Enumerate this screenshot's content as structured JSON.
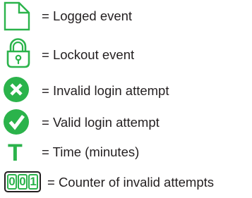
{
  "colors": {
    "accent_green": "#2bb34b",
    "text": "#231f20"
  },
  "legend": {
    "items": [
      {
        "icon": "document-icon",
        "label": "= Logged event"
      },
      {
        "icon": "padlock-icon",
        "label": "= Lockout event"
      },
      {
        "icon": "x-circle-icon",
        "label": "= Invalid login attempt"
      },
      {
        "icon": "check-circle-icon",
        "label": "= Valid login attempt"
      },
      {
        "icon": "t-letter-icon",
        "label": "= Time (minutes)",
        "glyph": "T"
      },
      {
        "icon": "counter-icon",
        "label": "= Counter of invalid attempts",
        "digits": [
          "0",
          "0",
          "1"
        ]
      }
    ]
  }
}
